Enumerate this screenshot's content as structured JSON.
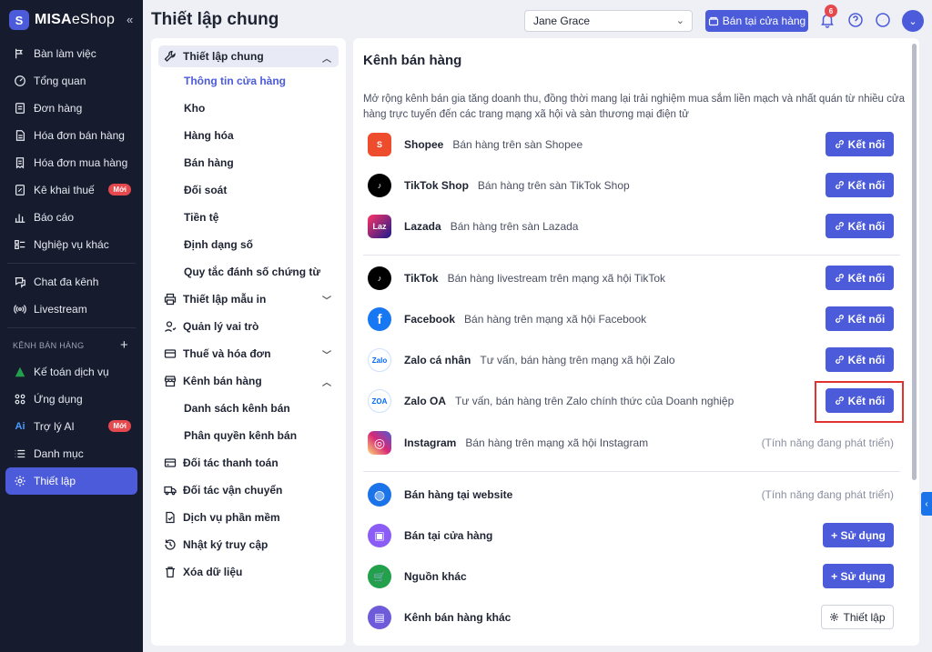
{
  "sidebar": {
    "brand_main": "MISA",
    "brand_sub": "eShop",
    "collapse_icon": "«",
    "items": [
      {
        "label": "Bàn làm việc",
        "icon": "workspace-icon"
      },
      {
        "label": "Tổng quan",
        "icon": "dashboard-icon"
      },
      {
        "label": "Đơn hàng",
        "icon": "order-icon"
      },
      {
        "label": "Hóa đơn bán hàng",
        "icon": "invoice-icon"
      },
      {
        "label": "Hóa đơn mua hàng",
        "icon": "purchase-invoice-icon"
      },
      {
        "label": "Kê khai thuế",
        "icon": "tax-icon",
        "badge": "Mới"
      },
      {
        "label": "Báo cáo",
        "icon": "report-icon"
      },
      {
        "label": "Nghiệp vụ khác",
        "icon": "other-ops-icon"
      }
    ],
    "items2": [
      {
        "label": "Chat đa kênh",
        "icon": "chat-icon"
      },
      {
        "label": "Livestream",
        "icon": "livestream-icon"
      }
    ],
    "section_label": "KÊNH BÁN HÀNG",
    "section_add": "+",
    "items3": [
      {
        "label": "Kế toán dịch vụ",
        "icon": "accounting-icon"
      },
      {
        "label": "Ứng dụng",
        "icon": "apps-icon"
      },
      {
        "label": "Trợ lý AI",
        "icon": "ai-icon",
        "badge": "Mới"
      },
      {
        "label": "Danh mục",
        "icon": "list-icon"
      },
      {
        "label": "Thiết lập",
        "icon": "settings-icon"
      }
    ]
  },
  "header": {
    "title": "Thiết lập chung",
    "user": "Jane Grace",
    "store_button": "Bán tại cửa hàng",
    "notification_count": "6",
    "avatar_chevron": "⌄"
  },
  "settings_menu": {
    "general": "Thiết lập chung",
    "general_children": [
      "Thông tin cửa hàng",
      "Kho",
      "Hàng hóa",
      "Bán hàng",
      "Đối soát",
      "Tiền tệ",
      "Định dạng số",
      "Quy tắc đánh số chứng từ"
    ],
    "print_templates": "Thiết lập mẫu in",
    "roles": "Quản lý vai trò",
    "tax_invoice": "Thuế và hóa đơn",
    "sales_channels": "Kênh bán hàng",
    "sales_channels_children": [
      "Danh sách kênh bán",
      "Phân quyền kênh bán"
    ],
    "payment_partners": "Đối tác thanh toán",
    "shipping_partners": "Đối tác vận chuyển",
    "software_services": "Dịch vụ phần mềm",
    "access_log": "Nhật ký truy cập",
    "delete_data": "Xóa dữ liệu"
  },
  "content": {
    "title": "Kênh bán hàng",
    "description": "Mở rộng kênh bán gia tăng doanh thu, đồng thời mang lại trải nghiệm mua sắm liền mạch và nhất quán từ nhiều cửa hàng trực tuyến đến các trang mạng xã hội và sàn thương mại điện tử",
    "connect_label": "Kết nối",
    "use_label": "+ Sử dụng",
    "setup_label": "Thiết lập",
    "dev_note": "(Tính năng đang phát triển)",
    "channels": [
      {
        "name": "Shopee",
        "desc": "Bán hàng trên sàn Shopee",
        "color": "#ee4d2d",
        "logo": "S"
      },
      {
        "name": "TikTok Shop",
        "desc": "Bán hàng trên sàn TikTok Shop",
        "color": "#000000",
        "logo": "♪"
      },
      {
        "name": "Lazada",
        "desc": "Bán hàng trên sàn Lazada",
        "color": "#1a1a8c",
        "logo": "Laz"
      },
      {
        "name": "TikTok",
        "desc": "Bán hàng livestream trên mạng xã hội TikTok",
        "color": "#000000",
        "logo": "♪"
      },
      {
        "name": "Facebook",
        "desc": "Bán hàng trên mạng xã hội Facebook",
        "color": "#1877f2",
        "logo": "f"
      },
      {
        "name": "Zalo cá nhân",
        "desc": "Tư vấn, bán hàng trên mạng xã hội Zalo",
        "color": "#0068ff",
        "logo": "Zalo"
      },
      {
        "name": "Zalo OA",
        "desc": "Tư vấn, bán hàng trên Zalo chính thức của Doanh nghiệp",
        "color": "#0068ff",
        "logo": "ZOA"
      },
      {
        "name": "Instagram",
        "desc": "Bán hàng trên mạng xã hội Instagram",
        "color": "#d62976",
        "logo": "◎"
      },
      {
        "name": "Bán hàng tại website",
        "desc": "",
        "color": "#1a73e8",
        "logo": "◍"
      },
      {
        "name": "Bán tại cửa hàng",
        "desc": "",
        "color": "#8b5cf6",
        "logo": "▣"
      },
      {
        "name": "Nguồn khác",
        "desc": "",
        "color": "#22a04b",
        "logo": "🛒"
      },
      {
        "name": "Kênh bán hàng khác",
        "desc": "",
        "color": "#6d5bd9",
        "logo": "▤"
      }
    ]
  },
  "colors": {
    "accent": "#4b5bd9",
    "sidebar_bg": "#161b2e",
    "highlight": "#e0322e"
  }
}
